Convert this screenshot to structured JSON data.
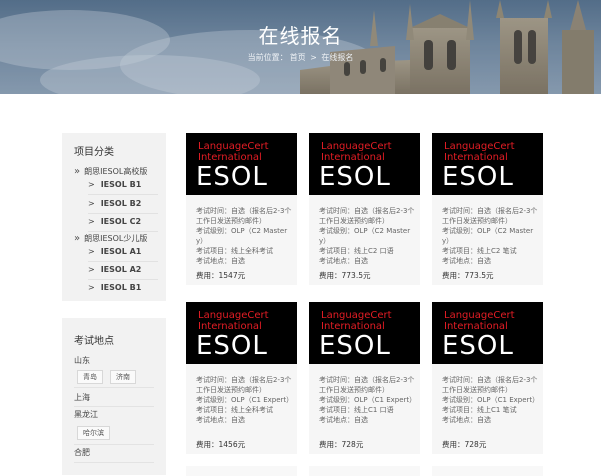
{
  "hero": {
    "title": "在线报名",
    "breadcrumb": {
      "prefix": "当前位置：",
      "home": "首页",
      "sep": ">",
      "current": "在线报名"
    }
  },
  "sidebar": {
    "categories": {
      "title": "项目分类",
      "groups": [
        {
          "label": "朗思IESOL高校版",
          "items": [
            "IESOL B1",
            "IESOL B2",
            "IESOL C2"
          ]
        },
        {
          "label": "朗思IESOL少儿版",
          "items": [
            "IESOL A1",
            "IESOL A2",
            "IESOL B1"
          ]
        }
      ]
    },
    "locations": {
      "title": "考试地点",
      "provinces": [
        {
          "name": "山东",
          "cities": [
            "青岛",
            "济南"
          ]
        },
        {
          "name": "上海",
          "cities": []
        },
        {
          "name": "黑龙江",
          "cities": [
            "哈尔滨"
          ]
        },
        {
          "name": "合肥",
          "cities": []
        }
      ]
    }
  },
  "logo": {
    "line1": "LanguageCert",
    "line2": "International",
    "brand": "ESOL"
  },
  "cards": [
    {
      "time": "考试时间：自选（报名后2-3个工作日发送预约邮件）",
      "level": "考试级别：OLP（C2 Mastery）",
      "project": "考试项目：线上全科考试",
      "place": "考试地点：自选",
      "fee": "费用：1547元"
    },
    {
      "time": "考试时间：自选（报名后2-3个工作日发送预约邮件）",
      "level": "考试级别：OLP（C2 Mastery）",
      "project": "考试项目：线上C2 口语",
      "place": "考试地点：自选",
      "fee": "费用：773.5元"
    },
    {
      "time": "考试时间：自选（报名后2-3个工作日发送预约邮件）",
      "level": "考试级别：OLP（C2 Mastery）",
      "project": "考试项目：线上C2 笔试",
      "place": "考试地点：自选",
      "fee": "费用：773.5元"
    },
    {
      "time": "考试时间：自选（报名后2-3个工作日发送预约邮件）",
      "level": "考试级别：OLP（C1 Expert）",
      "project": "考试项目：线上全科考试",
      "place": "考试地点：自选",
      "fee": "费用：1456元"
    },
    {
      "time": "考试时间：自选（报名后2-3个工作日发送预约邮件）",
      "level": "考试级别：OLP（C1 Expert）",
      "project": "考试项目：线上C1 口语",
      "place": "考试地点：自选",
      "fee": "费用：728元"
    },
    {
      "time": "考试时间：自选（报名后2-3个工作日发送预约邮件）",
      "level": "考试级别：OLP（C1 Expert）",
      "project": "考试项目：线上C1 笔试",
      "place": "考试地点：自选",
      "fee": "费用：728元"
    }
  ],
  "colors": {
    "brand_red": "#e31d25",
    "logo_bg": "#000000",
    "sidebar_bg": "#f2f2f2"
  }
}
